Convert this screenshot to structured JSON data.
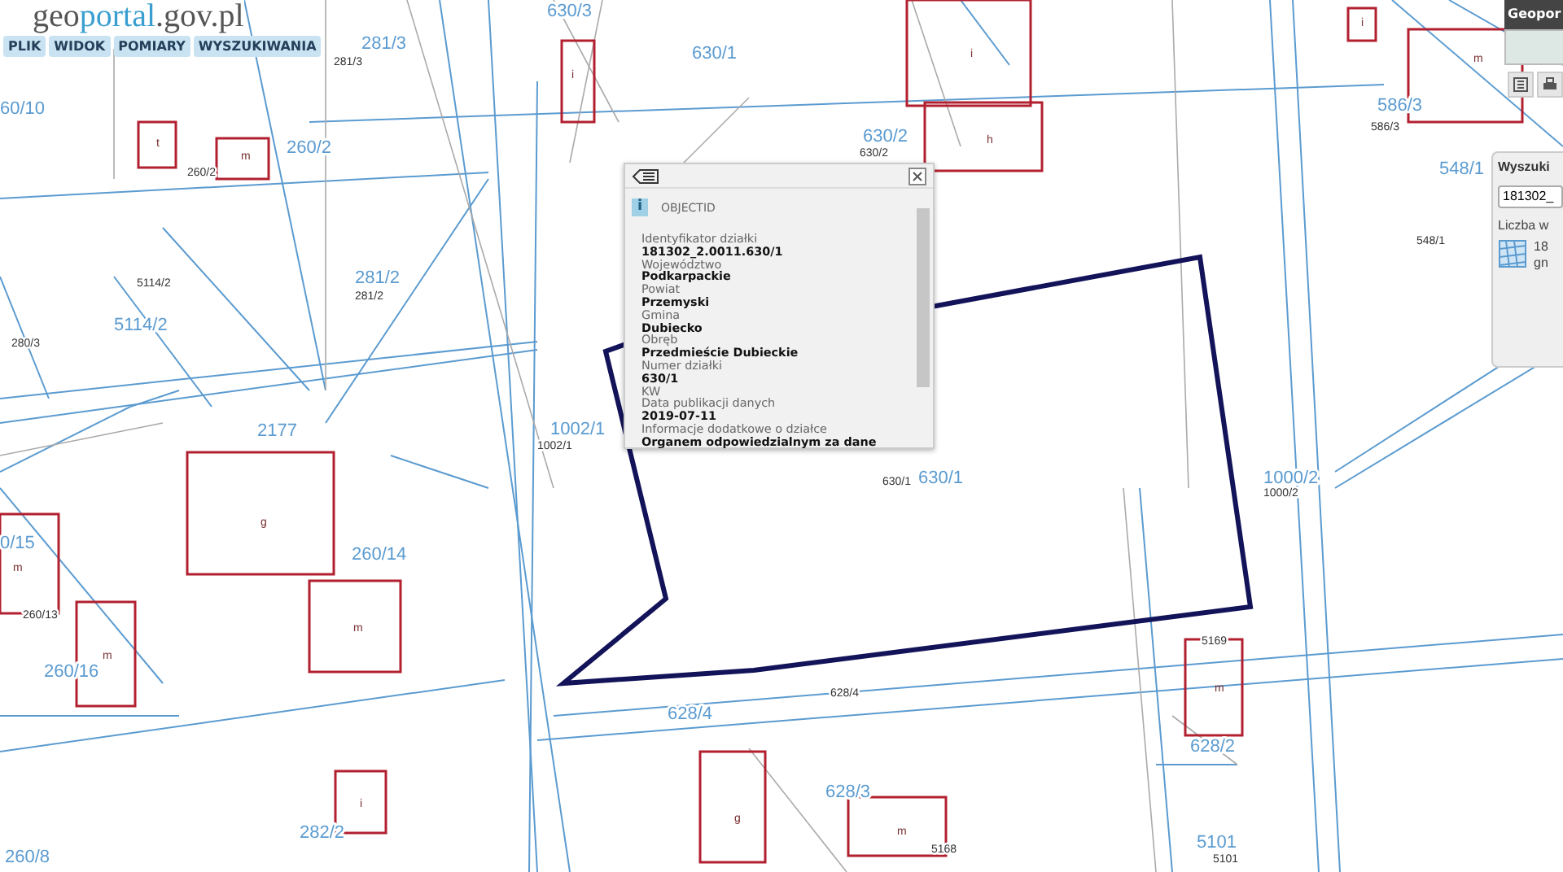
{
  "logo": {
    "parts": [
      "geo",
      "portal",
      ".gov.pl"
    ]
  },
  "menu": [
    "PLIK",
    "WIDOK",
    "POMIARY",
    "WYSZUKIWANIA"
  ],
  "map": {
    "parcel_numbers": [
      "281/3",
      "630/3",
      "60/10",
      "260/2",
      "281/2",
      "5114/2",
      "630/1",
      "630/2",
      "586/3",
      "548/1",
      "2177",
      "1002/1",
      "630/1",
      "1000/2",
      "0/15",
      "260/14",
      "260/16",
      "628/4",
      "628/3",
      "282/2",
      "5101",
      "628/2",
      "260/8"
    ],
    "parcel_ids": [
      "281/3",
      "260/2",
      "5114/2",
      "281/2",
      "280/3",
      "630/2",
      "586/3",
      "548/1",
      "1002/1",
      "630/1",
      "1000/2",
      "260/13",
      "628/4",
      "5101",
      "5168",
      "5169"
    ],
    "building_letters": [
      "i",
      "i",
      "h",
      "m",
      "t",
      "m",
      "i",
      "g",
      "m",
      "m",
      "m",
      "m",
      "i",
      "g",
      "m"
    ]
  },
  "popup": {
    "icon": "i",
    "title": "OBJECTID",
    "fields": [
      {
        "label": "Identyfikator działki",
        "value": "181302_2.0011.630/1"
      },
      {
        "label": "Województwo",
        "value": "Podkarpackie"
      },
      {
        "label": "Powiat",
        "value": "Przemyski"
      },
      {
        "label": "Gmina",
        "value": "Dubiecko"
      },
      {
        "label": "Obręb",
        "value": "Przedmieście Dubieckie"
      },
      {
        "label": "Numer działki",
        "value": "630/1"
      },
      {
        "label": "KW"
      },
      {
        "label": "Data publikacji danych",
        "value": "2019-07-11"
      },
      {
        "label": "Informacje dodatkowe o działce",
        "value": "Organem odpowiedzialnym za dane"
      }
    ]
  },
  "overview": {
    "title": "Geopor"
  },
  "search_panel": {
    "title": "Wyszuki",
    "query": "181302_",
    "count_label": "Liczba w",
    "result_lines": [
      "18",
      "gn"
    ]
  }
}
